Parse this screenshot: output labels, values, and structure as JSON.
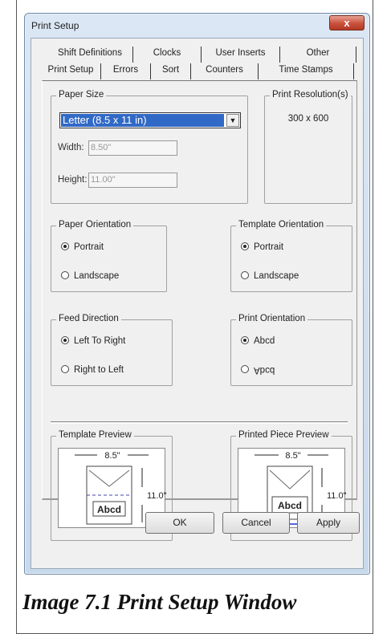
{
  "window": {
    "title": "Print Setup",
    "close_label": "x"
  },
  "tabs_back": [
    "Shift Definitions",
    "Clocks",
    "User Inserts",
    "Other"
  ],
  "tabs_front": [
    "Print Setup",
    "Errors",
    "Sort",
    "Counters",
    "Time Stamps"
  ],
  "active_tab": "Print Setup",
  "paper_size": {
    "legend": "Paper Size",
    "selected": "Letter (8.5 x 11 in)",
    "width_label": "Width:",
    "width_value": "8.50\"",
    "height_label": "Height:",
    "height_value": "11.00\""
  },
  "resolution": {
    "legend": "Print Resolution(s)",
    "value": "300 x 600"
  },
  "paper_orientation": {
    "legend": "Paper Orientation",
    "options": [
      "Portrait",
      "Landscape"
    ],
    "selected": "Portrait"
  },
  "template_orientation": {
    "legend": "Template Orientation",
    "options": [
      "Portrait",
      "Landscape"
    ],
    "selected": "Portrait"
  },
  "feed_direction": {
    "legend": "Feed Direction",
    "options": [
      "Left To Right",
      "Right to Left"
    ],
    "selected": "Left To Right"
  },
  "print_orientation": {
    "legend": "Print Orientation",
    "options": [
      "Abcd",
      "Abcd"
    ],
    "selected": "Abcd"
  },
  "template_preview": {
    "legend": "Template Preview",
    "width_label": "8.5\"",
    "height_label": "11.0\"",
    "sample_text": "Abcd"
  },
  "printed_preview": {
    "legend": "Printed Piece Preview",
    "width_label": "8.5\"",
    "height_label": "11.0\"",
    "sample_text": "Abcd"
  },
  "buttons": {
    "ok": "OK",
    "cancel": "Cancel",
    "apply": "Apply"
  },
  "caption": "Image 7.1 Print Setup Window",
  "colors": {
    "selection": "#3169c6",
    "close": "#c9503b",
    "arrow": "#2233cc",
    "dashed_line": "#4444aa"
  }
}
